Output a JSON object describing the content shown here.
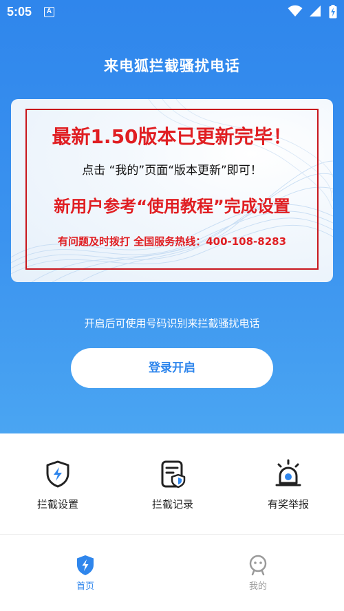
{
  "status_bar": {
    "time": "5:05",
    "notification_badge": "A",
    "icons": [
      "wifi-icon",
      "signal-icon",
      "battery-charging-icon"
    ]
  },
  "app_title": "来电狐拦截骚扰电话",
  "banner": {
    "line1": "最新1.50版本已更新完毕！",
    "line2": "点击 “我的”页面“版本更新”即可！",
    "line3": "新用户参考“使用教程”完成设置",
    "line4": "有问题及时拨打 全国服务热线：400-108-8283",
    "accent_color": "#e01e22",
    "frame_color": "#c8161d"
  },
  "hint_text": "开启后可使用号码识别来拦截骚扰电话",
  "login_button": "登录开启",
  "shortcuts": [
    {
      "label": "拦截设置",
      "icon": "shield-lightning-icon"
    },
    {
      "label": "拦截记录",
      "icon": "document-shield-icon"
    },
    {
      "label": "有奖举报",
      "icon": "alarm-siren-icon"
    }
  ],
  "tabs": [
    {
      "label": "首页",
      "icon": "home-shield-icon",
      "active": true
    },
    {
      "label": "我的",
      "icon": "profile-face-icon",
      "active": false
    }
  ],
  "colors": {
    "primary": "#2f86ec",
    "inactive": "#9a9a9a"
  }
}
